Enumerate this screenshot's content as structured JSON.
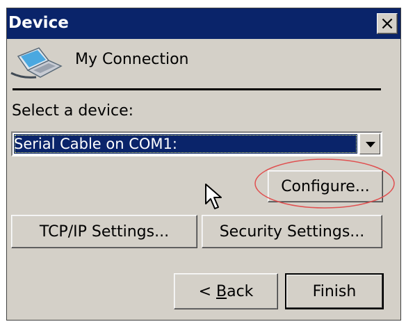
{
  "window": {
    "title": "Device",
    "close_label": "×"
  },
  "connection": {
    "icon": "computer-network-icon",
    "name": "My Connection"
  },
  "device_select": {
    "label": "Select a device:",
    "selected_value": "Serial Cable on COM1:"
  },
  "buttons": {
    "configure": "Configure...",
    "tcpip_settings": "TCP/IP Settings...",
    "security_settings": "Security Settings...",
    "back_prefix": "< ",
    "back_mnemonic": "B",
    "back_rest": "ack",
    "finish": "Finish"
  },
  "colors": {
    "titlebar": "#0a246a",
    "dialog_bg": "#d4d0c8",
    "selection": "#0a246a",
    "annotation": "#e05050"
  }
}
